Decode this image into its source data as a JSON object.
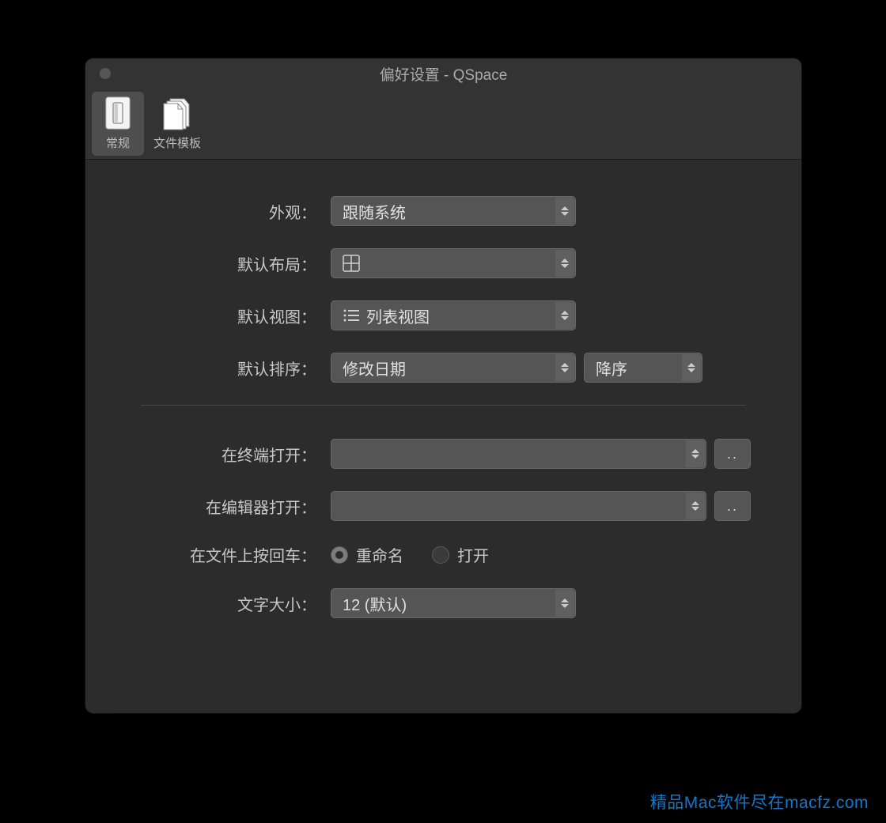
{
  "window": {
    "title": "偏好设置 - QSpace"
  },
  "toolbar": {
    "items": [
      {
        "id": "general",
        "label": "常规",
        "active": true
      },
      {
        "id": "file-templates",
        "label": "文件模板",
        "active": false
      }
    ]
  },
  "settings": {
    "appearance": {
      "label": "外观：",
      "value": "跟随系统"
    },
    "default_layout": {
      "label": "默认布局：",
      "value": ""
    },
    "default_view": {
      "label": "默认视图：",
      "value": "列表视图"
    },
    "default_sort": {
      "label": "默认排序：",
      "value": "修改日期",
      "order": "降序"
    },
    "open_in_terminal": {
      "label": "在终端打开：",
      "value": ""
    },
    "open_in_editor": {
      "label": "在编辑器打开：",
      "value": ""
    },
    "enter_on_file": {
      "label": "在文件上按回车：",
      "options": [
        {
          "label": "重命名",
          "checked": true
        },
        {
          "label": "打开",
          "checked": false
        }
      ]
    },
    "text_size": {
      "label": "文字大小：",
      "value": "12 (默认)"
    },
    "browse_button": ".."
  },
  "watermark": "精品Mac软件尽在macfz.com"
}
